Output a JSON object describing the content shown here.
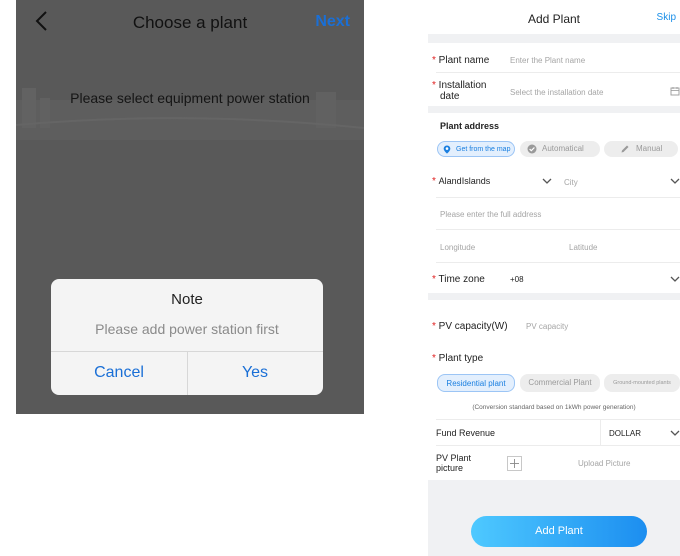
{
  "left": {
    "title": "Choose a plant",
    "next_label": "Next",
    "hint": "Please select equipment power station",
    "dialog": {
      "title": "Note",
      "message": "Please add power station first",
      "cancel_label": "Cancel",
      "yes_label": "Yes"
    }
  },
  "right": {
    "title": "Add Plant",
    "skip_label": "Skip",
    "plant_name": {
      "label": "Plant name",
      "placeholder": "Enter the Plant name"
    },
    "installation_date": {
      "label_line1": "Installation",
      "label_line2": "date",
      "placeholder": "Select the installation date"
    },
    "plant_address": {
      "heading": "Plant address",
      "options": [
        "Get from the map",
        "Automatical",
        "Manual"
      ],
      "country": "AlandIslands",
      "city_placeholder": "City",
      "address_placeholder": "Please enter the full address",
      "longitude_placeholder": "Longitude",
      "latitude_placeholder": "Latitude"
    },
    "time_zone": {
      "label": "Time zone",
      "value": "+08"
    },
    "pv_capacity": {
      "label": "PV capacity(W)",
      "placeholder": "PV capacity"
    },
    "plant_type": {
      "label": "Plant type",
      "options": [
        "Residential plant",
        "Commercial Plant",
        "Ground-mounted plants"
      ],
      "note": "(Conversion standard based on 1kWh power generation)"
    },
    "fund_revenue": {
      "label": "Fund Revenue",
      "currency": "DOLLAR"
    },
    "pv_picture": {
      "label_line1": "PV Plant",
      "label_line2": "picture",
      "upload_label": "Upload Picture"
    },
    "submit_label": "Add Plant",
    "colors": {
      "accent": "#1a8fe8",
      "required": "#e02020",
      "overlay": "#595959"
    }
  }
}
